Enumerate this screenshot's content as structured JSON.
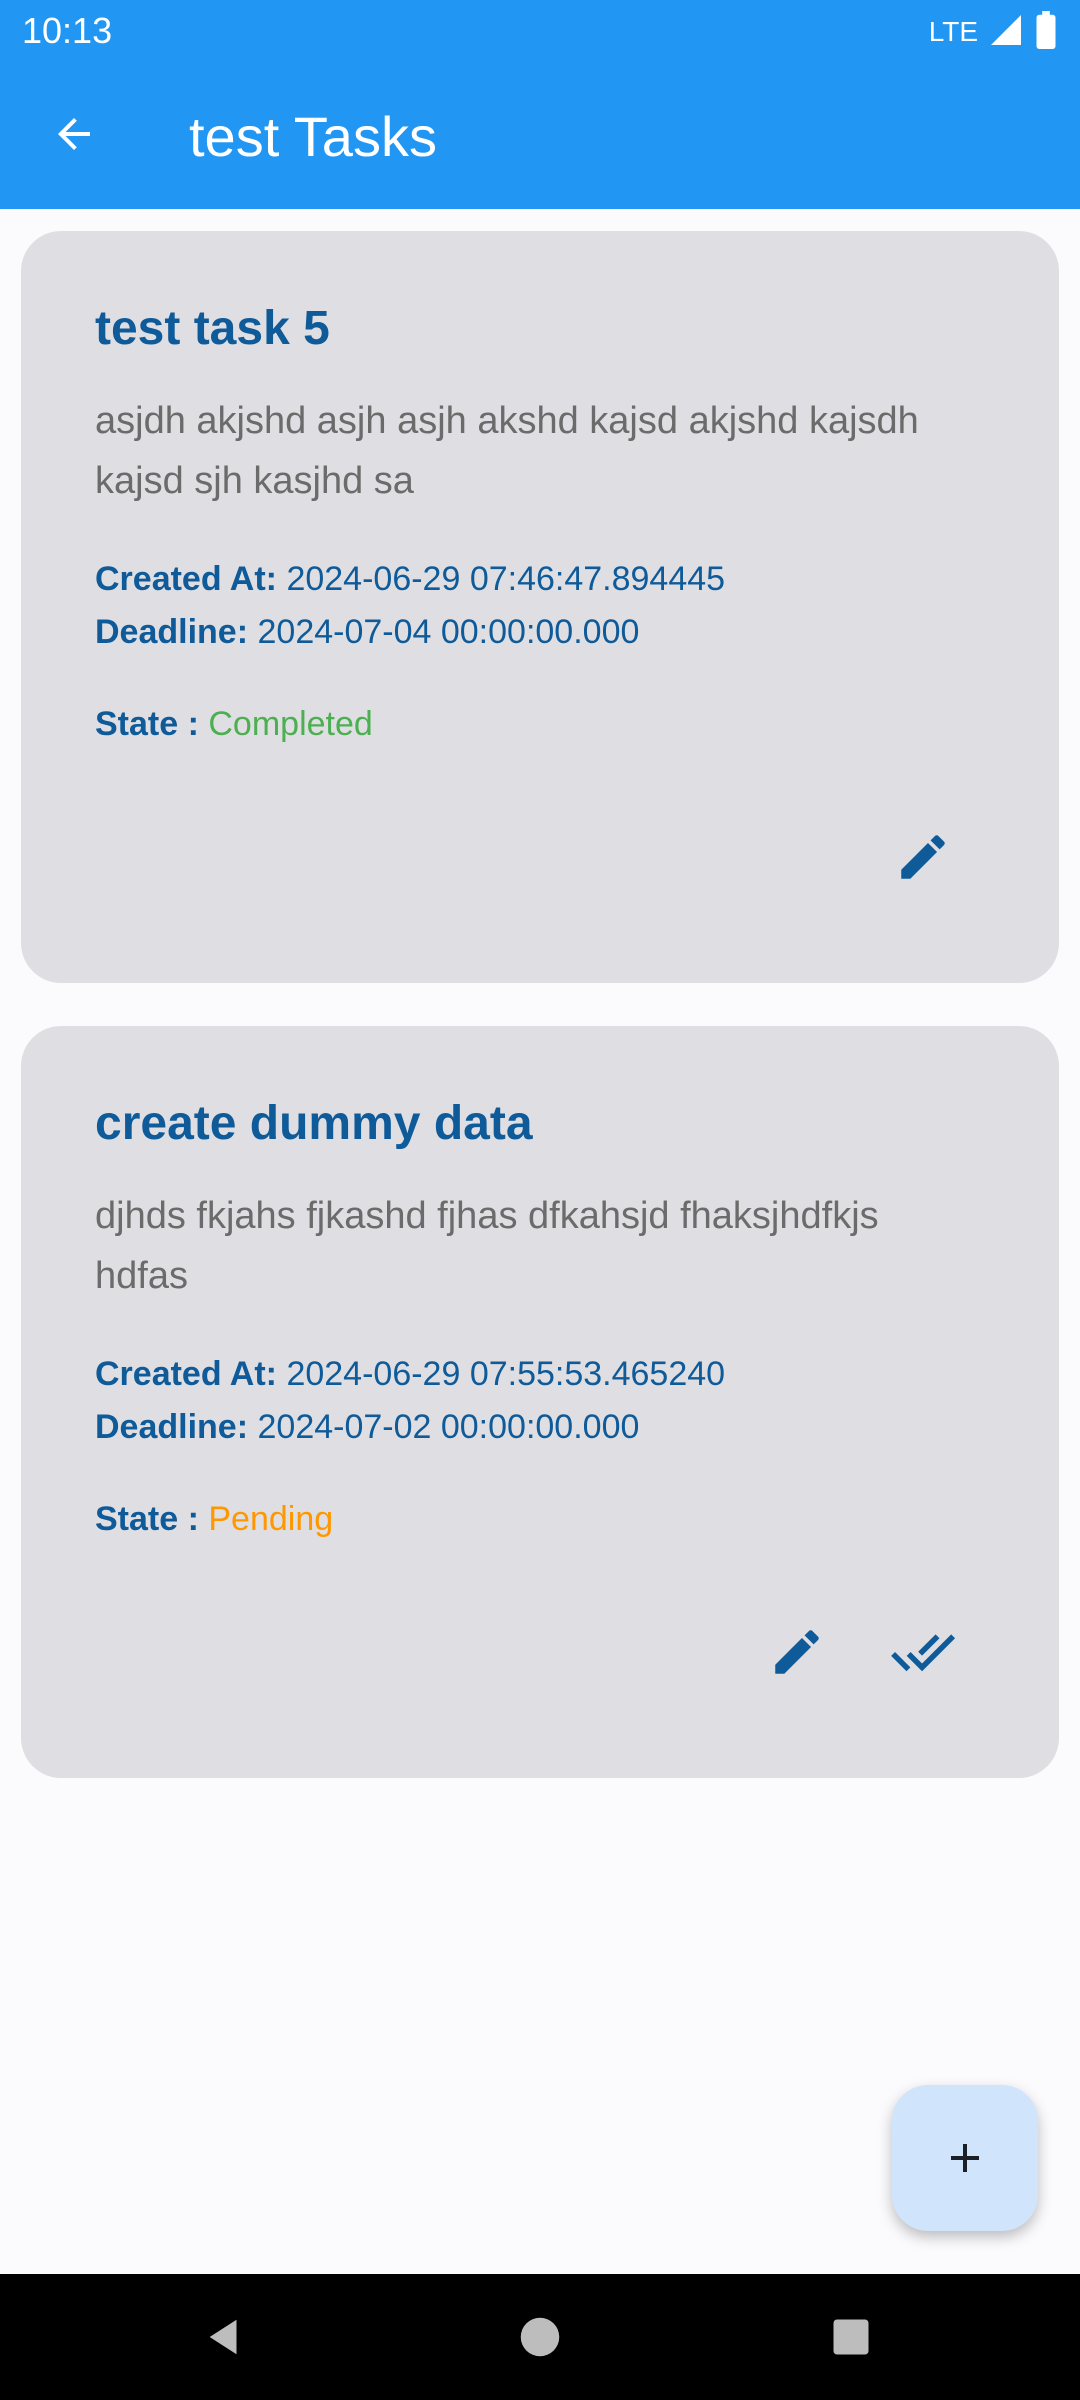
{
  "status_bar": {
    "time": "10:13",
    "network": "LTE"
  },
  "app_bar": {
    "title": "test Tasks",
    "back_icon": "arrow-back-icon"
  },
  "tasks": [
    {
      "title": "test task 5",
      "description": "asjdh akjshd asjh asjh akshd kajsd akjshd kajsdh kajsd sjh kasjhd sa",
      "created_label": "Created At:",
      "created_at": "2024-06-29 07:46:47.894445",
      "deadline_label": "Deadline:",
      "deadline": "2024-07-04 00:00:00.000",
      "state_label": "State :",
      "state": "Completed",
      "state_color": "#4caf50",
      "actions": [
        "edit-icon"
      ]
    },
    {
      "title": "create dummy data",
      "description": "djhds fkjahs fjkashd fjhas dfkahsjd fhaksjhdfkjs hdfas",
      "created_label": "Created At:",
      "created_at": "2024-06-29 07:55:53.465240",
      "deadline_label": "Deadline:",
      "deadline": "2024-07-02 00:00:00.000",
      "state_label": "State :",
      "state": "Pending",
      "state_color": "#ff9800",
      "actions": [
        "edit-icon",
        "done-all-icon"
      ]
    }
  ],
  "fab": {
    "icon": "add-icon"
  },
  "colors": {
    "primary": "#2196f3",
    "text_accent": "#0f5a99",
    "card_bg": "#dfdfe3"
  }
}
